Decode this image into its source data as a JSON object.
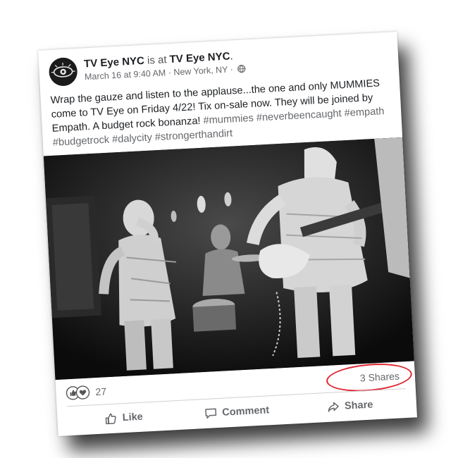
{
  "post": {
    "page_name": "TV Eye NYC",
    "is_at": "is at",
    "location_name": "TV Eye NYC",
    "location_suffix": ".",
    "date": "March 16 at 9:40 AM",
    "separator": "·",
    "place": "New York, NY",
    "privacy_icon": "globe-icon",
    "text": "Wrap the gauze and listen to the applause...the one and only MUMMIES come to TV Eye on Friday 4/22! Tix on-sale now. They will be joined by Empath. A budget rock bonanza!",
    "hashtags": [
      "#mummies",
      "#neverbeencaught",
      "#empath",
      "#budgetrock",
      "#dalycity",
      "#strongerthandirt"
    ]
  },
  "stats": {
    "reaction_icons": [
      "like-icon",
      "love-icon"
    ],
    "reaction_count": "27",
    "shares": "3 Shares"
  },
  "actions": {
    "like": "Like",
    "comment": "Comment",
    "share": "Share"
  },
  "colors": {
    "annotation_circle": "#e0242f",
    "muted_text": "#65676b",
    "body_text": "#1c1e21"
  }
}
